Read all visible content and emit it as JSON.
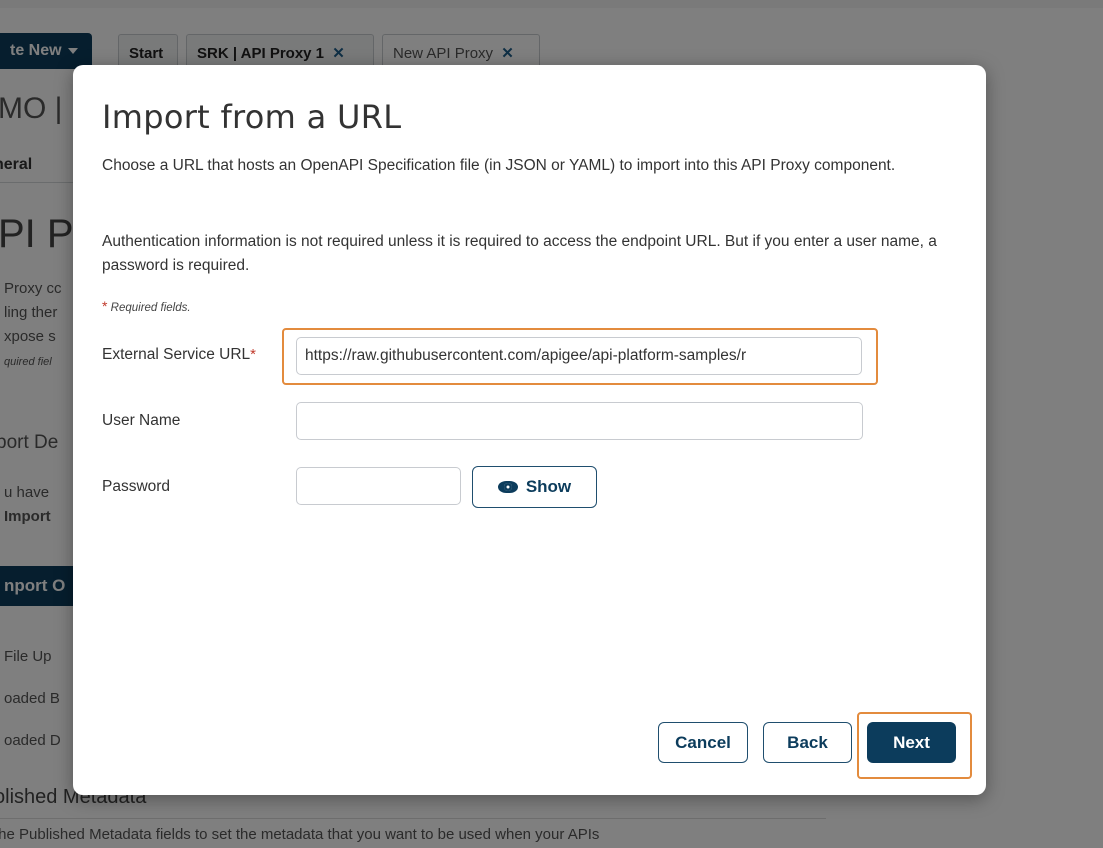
{
  "background": {
    "create_new_label": "te New",
    "tabs": [
      {
        "label": "Start"
      },
      {
        "label": "SRK | API Proxy 1"
      },
      {
        "label": "New API Proxy"
      }
    ],
    "tab_close_glyph": "✕",
    "page_title_fragment": "MO |",
    "subnav_fragment": "neral",
    "heading_fragment": "PI Pr",
    "text_fragments": [
      "Proxy cc",
      "ling ther",
      "xpose s",
      "quired fiel"
    ],
    "section_fragment": "port De",
    "para_fragments": [
      "u have",
      "Import"
    ],
    "import_button_fragment": "nport O",
    "list_fragments": [
      "File Up",
      "oaded B",
      "oaded D"
    ],
    "published_heading": "olished Metadata",
    "bottom_text": "the Published Metadata fields to set the metadata that you want to be used when your APIs"
  },
  "modal": {
    "title": "Import from a URL",
    "description_1": "Choose a URL that hosts an OpenAPI Specification file (in JSON or YAML) to import into this API Proxy component.",
    "description_2": "Authentication information is not required unless it is required to access the endpoint URL. But if you enter a user name, a password is required.",
    "required_star": "*",
    "required_note": "Required fields.",
    "fields": {
      "url_label": "External Service URL",
      "url_value": "https://raw.githubusercontent.com/apigee/api-platform-samples/r",
      "username_label": "User Name",
      "username_value": "",
      "password_label": "Password",
      "password_value": ""
    },
    "show_button_label": "Show",
    "buttons": {
      "cancel": "Cancel",
      "back": "Back",
      "next": "Next"
    }
  },
  "colors": {
    "primary": "#0c3c5c",
    "highlight": "#e38b3d",
    "required": "#c0392b"
  }
}
